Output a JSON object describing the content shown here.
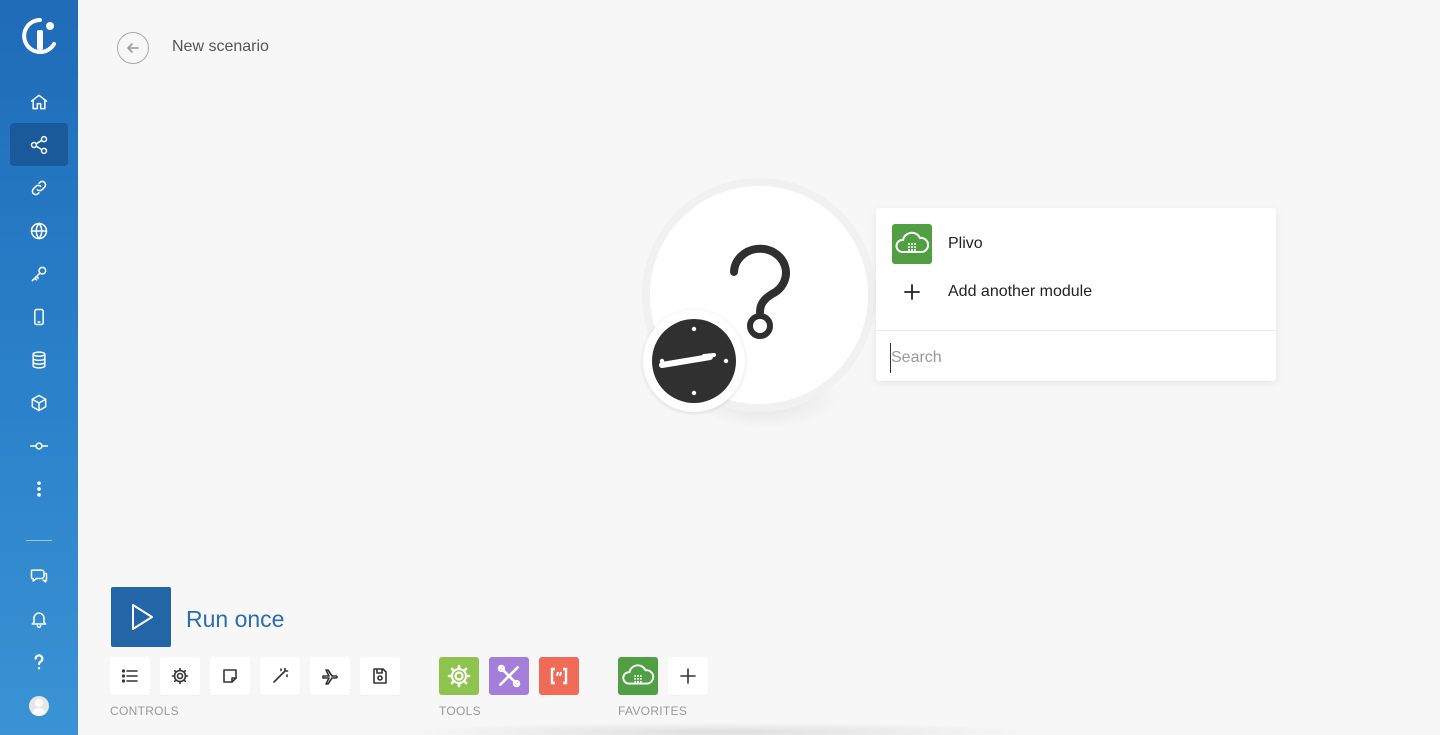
{
  "header": {
    "title": "New scenario"
  },
  "sidebar": {
    "items": [
      {
        "name": "home-icon"
      },
      {
        "name": "scenarios-icon",
        "active": true
      },
      {
        "name": "connections-icon"
      },
      {
        "name": "webhooks-icon"
      },
      {
        "name": "keys-icon"
      },
      {
        "name": "devices-icon"
      },
      {
        "name": "datastores-icon"
      },
      {
        "name": "datastructures-icon"
      },
      {
        "name": "flow-icon"
      },
      {
        "name": "more-icon"
      }
    ],
    "bottom": [
      {
        "name": "chat-icon"
      },
      {
        "name": "bell-icon"
      },
      {
        "name": "help-icon"
      },
      {
        "name": "avatar-icon"
      }
    ]
  },
  "popover": {
    "item1_label": "Plivo",
    "item2_label": "Add another module",
    "search_placeholder": "Search"
  },
  "toolbar": {
    "run_label": "Run once",
    "controls_label": "CONTROLS",
    "tools_label": "TOOLS",
    "favorites_label": "FAVORITES"
  },
  "colors": {
    "sidebar": "#1f6bb8",
    "run_button": "#2266a8",
    "plivo_green": "#519f43",
    "tool_gear": "#8ec44d",
    "tool_tools": "#a57ed9",
    "tool_text": "#ef6b57"
  }
}
